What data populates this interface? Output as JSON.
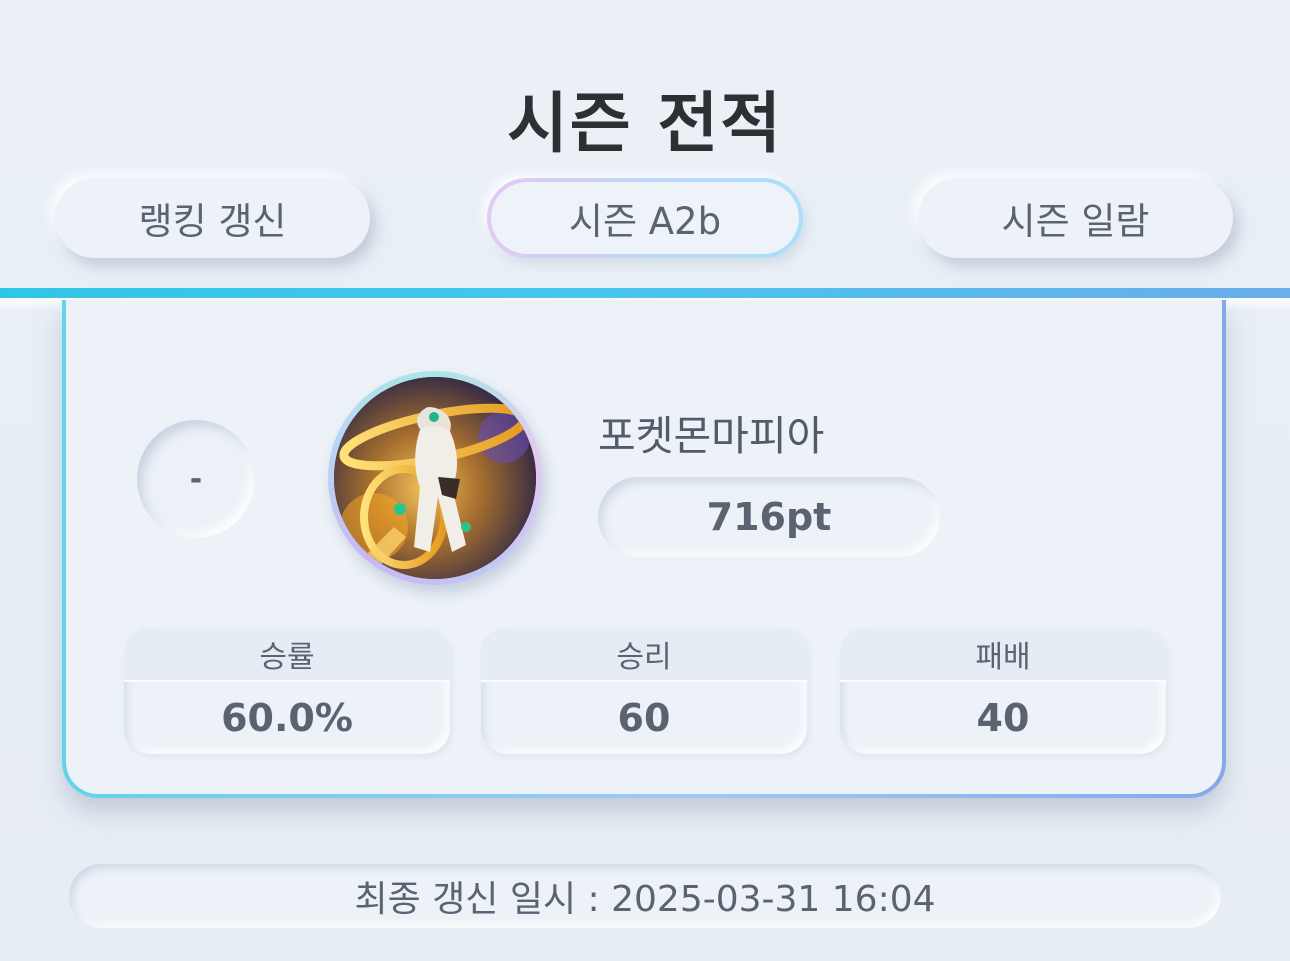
{
  "page": {
    "title": "시즌 전적"
  },
  "tabs": {
    "left": "랭킹 갱신",
    "center": "시즌 A2b",
    "right": "시즌 일람"
  },
  "profile": {
    "rank": "-",
    "name": "포켓몬마피아",
    "points": "716pt"
  },
  "stats": [
    {
      "label": "승률",
      "value": "60.0%"
    },
    {
      "label": "승리",
      "value": "60"
    },
    {
      "label": "패배",
      "value": "40"
    }
  ],
  "footer": {
    "last_updated": "최종 갱신 일시 : 2025-03-31 16:04"
  },
  "colors": {
    "accent_cyan": "#2fc6e6",
    "accent_blue": "#6aaeea",
    "text_dark": "#2d2f33",
    "text_muted": "#5b6270",
    "surface": "#edf2f8"
  }
}
